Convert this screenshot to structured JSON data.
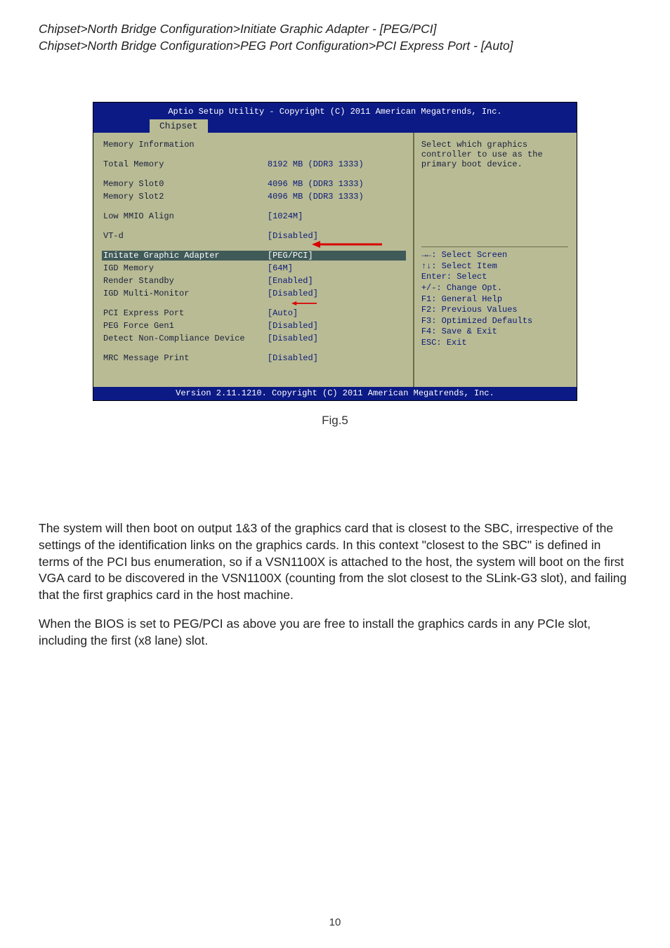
{
  "breadcrumbs": {
    "line1": "Chipset>North Bridge Configuration>Initiate Graphic Adapter  - [PEG/PCI]",
    "line2": "Chipset>North Bridge Configuration>PEG Port Configuration>PCI Express Port - [Auto]"
  },
  "bios": {
    "header_title": "Aptio Setup Utility - Copyright (C) 2011 American Megatrends, Inc.",
    "tab": "Chipset",
    "section_title": "Memory Information",
    "rows": {
      "total_memory_label": "Total Memory",
      "total_memory_value": "8192 MB (DDR3 1333)",
      "slot0_label": "Memory Slot0",
      "slot0_value": "4096 MB (DDR3 1333)",
      "slot2_label": "Memory Slot2",
      "slot2_value": "4096 MB (DDR3 1333)",
      "low_mmio_label": "Low MMIO Align",
      "low_mmio_value": "[1024M]",
      "vtd_label": "VT-d",
      "vtd_value": "[Disabled]",
      "init_gfx_label": "Initate Graphic Adapter",
      "init_gfx_value": "[PEG/PCI]",
      "igd_mem_label": "IGD Memory",
      "igd_mem_value": "[64M]",
      "render_standby_label": "Render Standby",
      "render_standby_value": "[Enabled]",
      "multi_mon_label": "IGD Multi-Monitor",
      "multi_mon_value": "[Disabled]",
      "pci_port_label": "PCI Express Port",
      "pci_port_value": "[Auto]",
      "peg_gen1_label": "PEG Force Gen1",
      "peg_gen1_value": "[Disabled]",
      "detect_nc_label": "Detect Non-Compliance Device",
      "detect_nc_value": "[Disabled]",
      "mrc_label": "MRC Message Print",
      "mrc_value": "[Disabled]"
    },
    "help_top": {
      "l1": "Select which graphics",
      "l2": "controller to use as the",
      "l3": "primary boot device."
    },
    "help_keys": {
      "k1": "→←: Select Screen",
      "k2": "↑↓: Select Item",
      "k3": "Enter: Select",
      "k4": "+/-: Change Opt.",
      "k5": "F1: General Help",
      "k6": "F2: Previous Values",
      "k7": "F3: Optimized Defaults",
      "k8": "F4: Save & Exit",
      "k9": "ESC: Exit"
    },
    "footer": "Version 2.11.1210. Copyright (C) 2011 American Megatrends, Inc."
  },
  "caption": "Fig.5",
  "paragraphs": {
    "p1": "The system will then boot on output 1&3  of the graphics card that is closest to the SBC, irrespective of the settings of the identification links on the graphics cards.  In this context \"closest to the SBC\" is defined in terms of the PCI bus enumeration, so if a VSN1100X is attached to the host, the system will boot on the first VGA card to be discovered in the VSN1100X (counting from the slot closest to the SLink-G3 slot), and failing that the first graphics card in the host machine.",
    "p2": "When the BIOS is set to PEG/PCI as above you are free to install the graphics cards in any PCIe slot, including the first (x8 lane) slot."
  },
  "page_number": "10"
}
